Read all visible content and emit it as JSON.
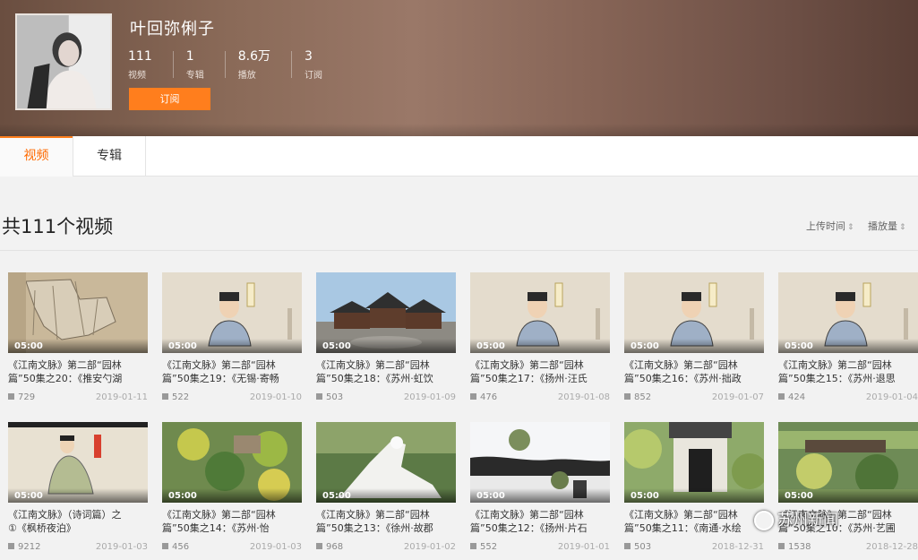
{
  "channel": {
    "name": "叶回弥俐子",
    "stats": [
      {
        "value": "111",
        "label": "视频"
      },
      {
        "value": "1",
        "label": "专辑"
      },
      {
        "value": "8.6万",
        "label": "播放"
      },
      {
        "value": "3",
        "label": "订阅"
      }
    ],
    "subscribe_label": "订阅"
  },
  "tabs": [
    {
      "label": "视频",
      "active": true
    },
    {
      "label": "专辑",
      "active": false
    }
  ],
  "section": {
    "title": "共111个视频",
    "sort_upload": "上传时间",
    "sort_plays": "播放量"
  },
  "videos": [
    {
      "duration": "05:00",
      "title1": "《江南文脉》第二部“园林",
      "title2": "篇”50集之20：《推安勺湖",
      "plays": "729",
      "date": "2019-01-11",
      "thumb": "map"
    },
    {
      "duration": "05:00",
      "title1": "《江南文脉》第二部“园林",
      "title2": "篇”50集之19：《无锡·寄畅",
      "plays": "522",
      "date": "2019-01-10",
      "thumb": "portrait"
    },
    {
      "duration": "05:00",
      "title1": "《江南文脉》第二部“园林",
      "title2": "篇”50集之18：《苏州·虹饮",
      "plays": "503",
      "date": "2019-01-09",
      "thumb": "building"
    },
    {
      "duration": "05:00",
      "title1": "《江南文脉》第二部“园林",
      "title2": "篇”50集之17：《扬州·汪氏",
      "plays": "476",
      "date": "2019-01-08",
      "thumb": "portrait"
    },
    {
      "duration": "05:00",
      "title1": "《江南文脉》第二部“园林",
      "title2": "篇”50集之16：《苏州·拙政",
      "plays": "852",
      "date": "2019-01-07",
      "thumb": "portrait"
    },
    {
      "duration": "05:00",
      "title1": "《江南文脉》第二部“园林",
      "title2": "篇”50集之15：《苏州·退思",
      "plays": "424",
      "date": "2019-01-04",
      "thumb": "portrait"
    },
    {
      "duration": "05:00",
      "title1": "《江南文脉》（诗词篇）之",
      "title2": "①《枫桥夜泊》",
      "plays": "9212",
      "date": "2019-01-03",
      "thumb": "painting"
    },
    {
      "duration": "05:00",
      "title1": "《江南文脉》第二部“园林",
      "title2": "篇”50集之14：《苏州·怡",
      "plays": "456",
      "date": "2019-01-03",
      "thumb": "garden"
    },
    {
      "duration": "05:00",
      "title1": "《江南文脉》第二部“园林",
      "title2": "篇”50集之13：《徐州·故郡",
      "plays": "968",
      "date": "2019-01-02",
      "thumb": "statue"
    },
    {
      "duration": "05:00",
      "title1": "《江南文脉》第二部“园林",
      "title2": "篇”50集之12：《扬州·片石",
      "plays": "552",
      "date": "2019-01-01",
      "thumb": "roof"
    },
    {
      "duration": "05:00",
      "title1": "《江南文脉》第二部“园林",
      "title2": "篇”50集之11：《南通·水绘",
      "plays": "503",
      "date": "2018-12-31",
      "thumb": "gate"
    },
    {
      "duration": "05:00",
      "title1": "《江南文脉》第二部“园林",
      "title2": "篇”50集之10：《苏州·艺圃",
      "plays": "1538",
      "date": "2018-12-28",
      "thumb": "garden2"
    }
  ],
  "watermark": "苏州新闻"
}
